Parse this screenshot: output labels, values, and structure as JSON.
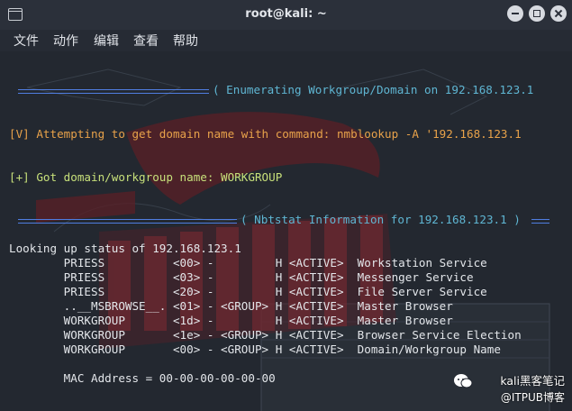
{
  "window": {
    "title": "root@kali: ~"
  },
  "menu": [
    "文件",
    "动作",
    "编辑",
    "查看",
    "帮助"
  ],
  "terminal": {
    "section_enum": "( Enumerating Workgroup/Domain on 192.168.123.1",
    "attempt": "[V] Attempting to get domain name with command: nmblookup -A '192.168.123.1",
    "got": "[+] Got domain/workgroup name: WORKGROUP",
    "section_nbt": "( Nbtstat Information for 192.168.123.1 )",
    "lookup": "Looking up status of 192.168.123.1",
    "rows": [
      "        PRIESS          <00> -         H <ACTIVE>  Workstation Service",
      "        PRIESS          <03> -         H <ACTIVE>  Messenger Service",
      "        PRIESS          <20> -         H <ACTIVE>  File Server Service",
      "        ..__MSBROWSE__. <01> - <GROUP> H <ACTIVE>  Master Browser",
      "        WORKGROUP       <1d> -         H <ACTIVE>  Master Browser",
      "        WORKGROUP       <1e> - <GROUP> H <ACTIVE>  Browser Service Election",
      "        WORKGROUP       <00> - <GROUP> H <ACTIVE>  Domain/Workgroup Name"
    ],
    "mac": "        MAC Address = 00-00-00-00-00-00"
  },
  "watermark": {
    "line1": "kali黑客笔记",
    "line2": "@ITPUB博客"
  }
}
